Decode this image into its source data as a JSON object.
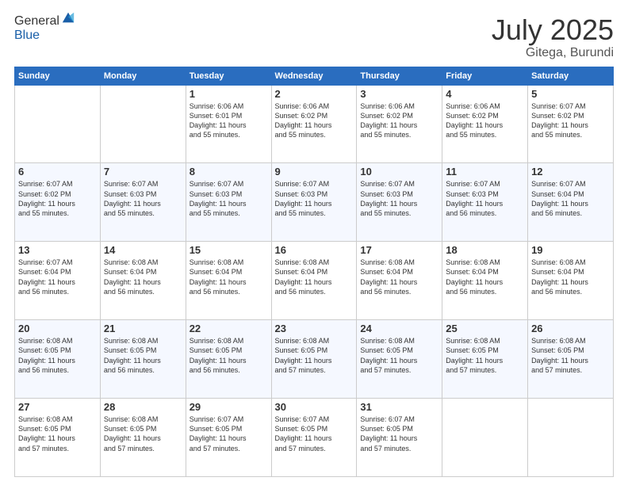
{
  "header": {
    "logo_general": "General",
    "logo_blue": "Blue",
    "title": "July 2025",
    "location": "Gitega, Burundi"
  },
  "days_of_week": [
    "Sunday",
    "Monday",
    "Tuesday",
    "Wednesday",
    "Thursday",
    "Friday",
    "Saturday"
  ],
  "weeks": [
    [
      {
        "day": "",
        "info": ""
      },
      {
        "day": "",
        "info": ""
      },
      {
        "day": "1",
        "info": "Sunrise: 6:06 AM\nSunset: 6:01 PM\nDaylight: 11 hours\nand 55 minutes."
      },
      {
        "day": "2",
        "info": "Sunrise: 6:06 AM\nSunset: 6:02 PM\nDaylight: 11 hours\nand 55 minutes."
      },
      {
        "day": "3",
        "info": "Sunrise: 6:06 AM\nSunset: 6:02 PM\nDaylight: 11 hours\nand 55 minutes."
      },
      {
        "day": "4",
        "info": "Sunrise: 6:06 AM\nSunset: 6:02 PM\nDaylight: 11 hours\nand 55 minutes."
      },
      {
        "day": "5",
        "info": "Sunrise: 6:07 AM\nSunset: 6:02 PM\nDaylight: 11 hours\nand 55 minutes."
      }
    ],
    [
      {
        "day": "6",
        "info": "Sunrise: 6:07 AM\nSunset: 6:02 PM\nDaylight: 11 hours\nand 55 minutes."
      },
      {
        "day": "7",
        "info": "Sunrise: 6:07 AM\nSunset: 6:03 PM\nDaylight: 11 hours\nand 55 minutes."
      },
      {
        "day": "8",
        "info": "Sunrise: 6:07 AM\nSunset: 6:03 PM\nDaylight: 11 hours\nand 55 minutes."
      },
      {
        "day": "9",
        "info": "Sunrise: 6:07 AM\nSunset: 6:03 PM\nDaylight: 11 hours\nand 55 minutes."
      },
      {
        "day": "10",
        "info": "Sunrise: 6:07 AM\nSunset: 6:03 PM\nDaylight: 11 hours\nand 55 minutes."
      },
      {
        "day": "11",
        "info": "Sunrise: 6:07 AM\nSunset: 6:03 PM\nDaylight: 11 hours\nand 56 minutes."
      },
      {
        "day": "12",
        "info": "Sunrise: 6:07 AM\nSunset: 6:04 PM\nDaylight: 11 hours\nand 56 minutes."
      }
    ],
    [
      {
        "day": "13",
        "info": "Sunrise: 6:07 AM\nSunset: 6:04 PM\nDaylight: 11 hours\nand 56 minutes."
      },
      {
        "day": "14",
        "info": "Sunrise: 6:08 AM\nSunset: 6:04 PM\nDaylight: 11 hours\nand 56 minutes."
      },
      {
        "day": "15",
        "info": "Sunrise: 6:08 AM\nSunset: 6:04 PM\nDaylight: 11 hours\nand 56 minutes."
      },
      {
        "day": "16",
        "info": "Sunrise: 6:08 AM\nSunset: 6:04 PM\nDaylight: 11 hours\nand 56 minutes."
      },
      {
        "day": "17",
        "info": "Sunrise: 6:08 AM\nSunset: 6:04 PM\nDaylight: 11 hours\nand 56 minutes."
      },
      {
        "day": "18",
        "info": "Sunrise: 6:08 AM\nSunset: 6:04 PM\nDaylight: 11 hours\nand 56 minutes."
      },
      {
        "day": "19",
        "info": "Sunrise: 6:08 AM\nSunset: 6:04 PM\nDaylight: 11 hours\nand 56 minutes."
      }
    ],
    [
      {
        "day": "20",
        "info": "Sunrise: 6:08 AM\nSunset: 6:05 PM\nDaylight: 11 hours\nand 56 minutes."
      },
      {
        "day": "21",
        "info": "Sunrise: 6:08 AM\nSunset: 6:05 PM\nDaylight: 11 hours\nand 56 minutes."
      },
      {
        "day": "22",
        "info": "Sunrise: 6:08 AM\nSunset: 6:05 PM\nDaylight: 11 hours\nand 56 minutes."
      },
      {
        "day": "23",
        "info": "Sunrise: 6:08 AM\nSunset: 6:05 PM\nDaylight: 11 hours\nand 57 minutes."
      },
      {
        "day": "24",
        "info": "Sunrise: 6:08 AM\nSunset: 6:05 PM\nDaylight: 11 hours\nand 57 minutes."
      },
      {
        "day": "25",
        "info": "Sunrise: 6:08 AM\nSunset: 6:05 PM\nDaylight: 11 hours\nand 57 minutes."
      },
      {
        "day": "26",
        "info": "Sunrise: 6:08 AM\nSunset: 6:05 PM\nDaylight: 11 hours\nand 57 minutes."
      }
    ],
    [
      {
        "day": "27",
        "info": "Sunrise: 6:08 AM\nSunset: 6:05 PM\nDaylight: 11 hours\nand 57 minutes."
      },
      {
        "day": "28",
        "info": "Sunrise: 6:08 AM\nSunset: 6:05 PM\nDaylight: 11 hours\nand 57 minutes."
      },
      {
        "day": "29",
        "info": "Sunrise: 6:07 AM\nSunset: 6:05 PM\nDaylight: 11 hours\nand 57 minutes."
      },
      {
        "day": "30",
        "info": "Sunrise: 6:07 AM\nSunset: 6:05 PM\nDaylight: 11 hours\nand 57 minutes."
      },
      {
        "day": "31",
        "info": "Sunrise: 6:07 AM\nSunset: 6:05 PM\nDaylight: 11 hours\nand 57 minutes."
      },
      {
        "day": "",
        "info": ""
      },
      {
        "day": "",
        "info": ""
      }
    ]
  ]
}
